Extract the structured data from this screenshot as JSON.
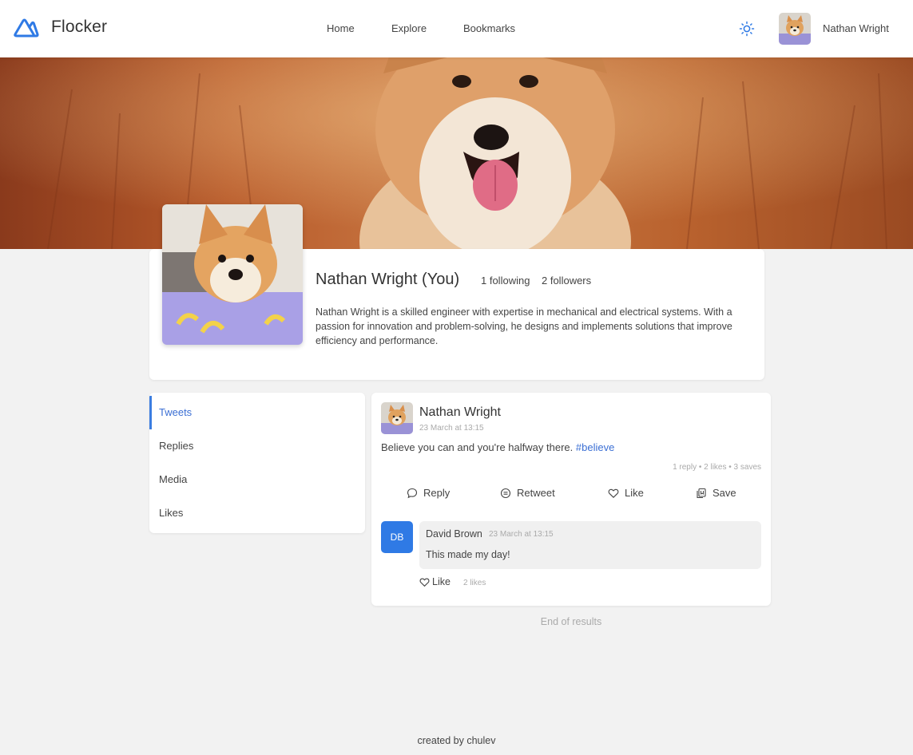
{
  "app": {
    "name": "Flocker",
    "accent": "#2f7ae5"
  },
  "nav": {
    "home": "Home",
    "explore": "Explore",
    "bookmarks": "Bookmarks"
  },
  "header": {
    "user_name": "Nathan Wright",
    "theme_icon": "sun-icon"
  },
  "profile": {
    "name": "Nathan Wright (You)",
    "following": "1 following",
    "followers": "2 followers",
    "bio": "Nathan Wright is a skilled engineer with expertise in mechanical and electrical systems. With a passion for innovation and problem-solving, he designs and implements solutions that improve efficiency and performance."
  },
  "tabs": [
    "Tweets",
    "Replies",
    "Media",
    "Likes"
  ],
  "tweet": {
    "author": "Nathan Wright",
    "time": "23 March at 13:15",
    "text": "Believe you can and you're halfway there.",
    "hashtag": "#believe",
    "stats": "1 reply • 2 likes • 3 saves",
    "actions": {
      "reply": "Reply",
      "retweet": "Retweet",
      "like": "Like",
      "save": "Save"
    },
    "reply": {
      "initials": "DB",
      "author": "David Brown",
      "time": "23 March at 13:15",
      "text": "This made my day!",
      "like": "Like",
      "likes": "2 likes"
    }
  },
  "end_text": "End of results",
  "footer": "created by chulev"
}
